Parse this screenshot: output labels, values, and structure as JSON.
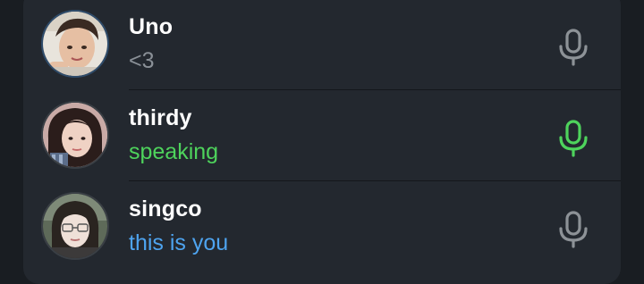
{
  "participants": [
    {
      "name": "Uno",
      "status": "<3",
      "status_type": "normal",
      "mic_state": "idle",
      "mic_color": "#8d9297",
      "avatar": "avatar-photo"
    },
    {
      "name": "thirdy",
      "status": "speaking",
      "status_type": "speaking",
      "mic_state": "active",
      "mic_color": "#4ed35c",
      "avatar": "avatar-photo"
    },
    {
      "name": "singco",
      "status": "this is you",
      "status_type": "you",
      "mic_state": "idle",
      "mic_color": "#8d9297",
      "avatar": "avatar-photo"
    }
  ],
  "colors": {
    "panel_bg": "#23282f",
    "page_bg": "#191d22",
    "speaking": "#4ed35c",
    "self": "#4ea4f0",
    "muted_text": "#8a9097"
  }
}
